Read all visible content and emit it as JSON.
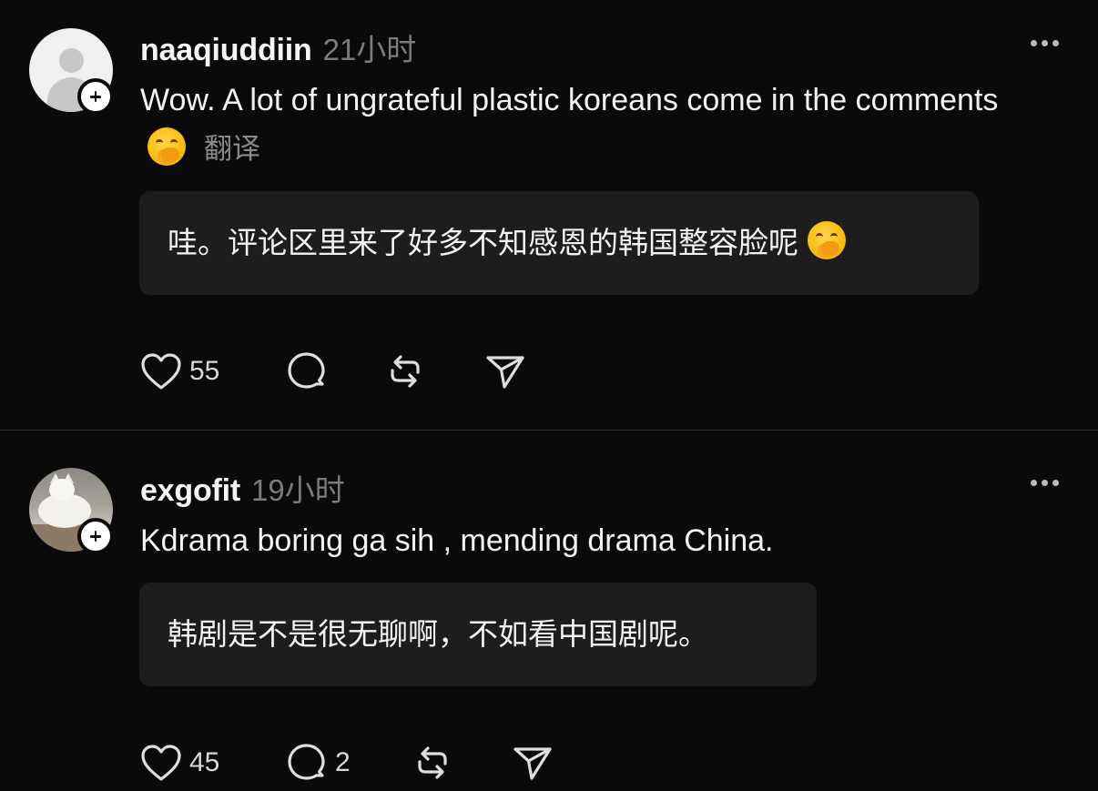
{
  "posts": [
    {
      "username": "naaqiuddiin",
      "timestamp": "21小时",
      "text": "Wow. A lot of ungrateful plastic koreans come in the comments",
      "emoji": "hand-over-mouth-emoji",
      "translate_label": "翻译",
      "translation": "哇。评论区里来了好多不知感恩的韩国整容脸呢",
      "like_count": "55",
      "reply_count": "",
      "avatar": "default-user-avatar"
    },
    {
      "username": "exgofit",
      "timestamp": "19小时",
      "text": "Kdrama boring ga sih , mending drama China.",
      "translation": "韩剧是不是很无聊啊，不如看中国剧呢。",
      "like_count": "45",
      "reply_count": "2",
      "avatar": "cat-photo-avatar"
    }
  ],
  "icons": {
    "like": "heart-icon",
    "reply": "speech-bubble-icon",
    "repost": "repost-icon",
    "share": "send-icon",
    "more": "more-dots-icon",
    "follow": "plus-icon"
  },
  "colors": {
    "background": "#0a0a0a",
    "text": "#f3f3f3",
    "muted": "#7c7c7c",
    "translation_bg": "#1e1c1c"
  }
}
